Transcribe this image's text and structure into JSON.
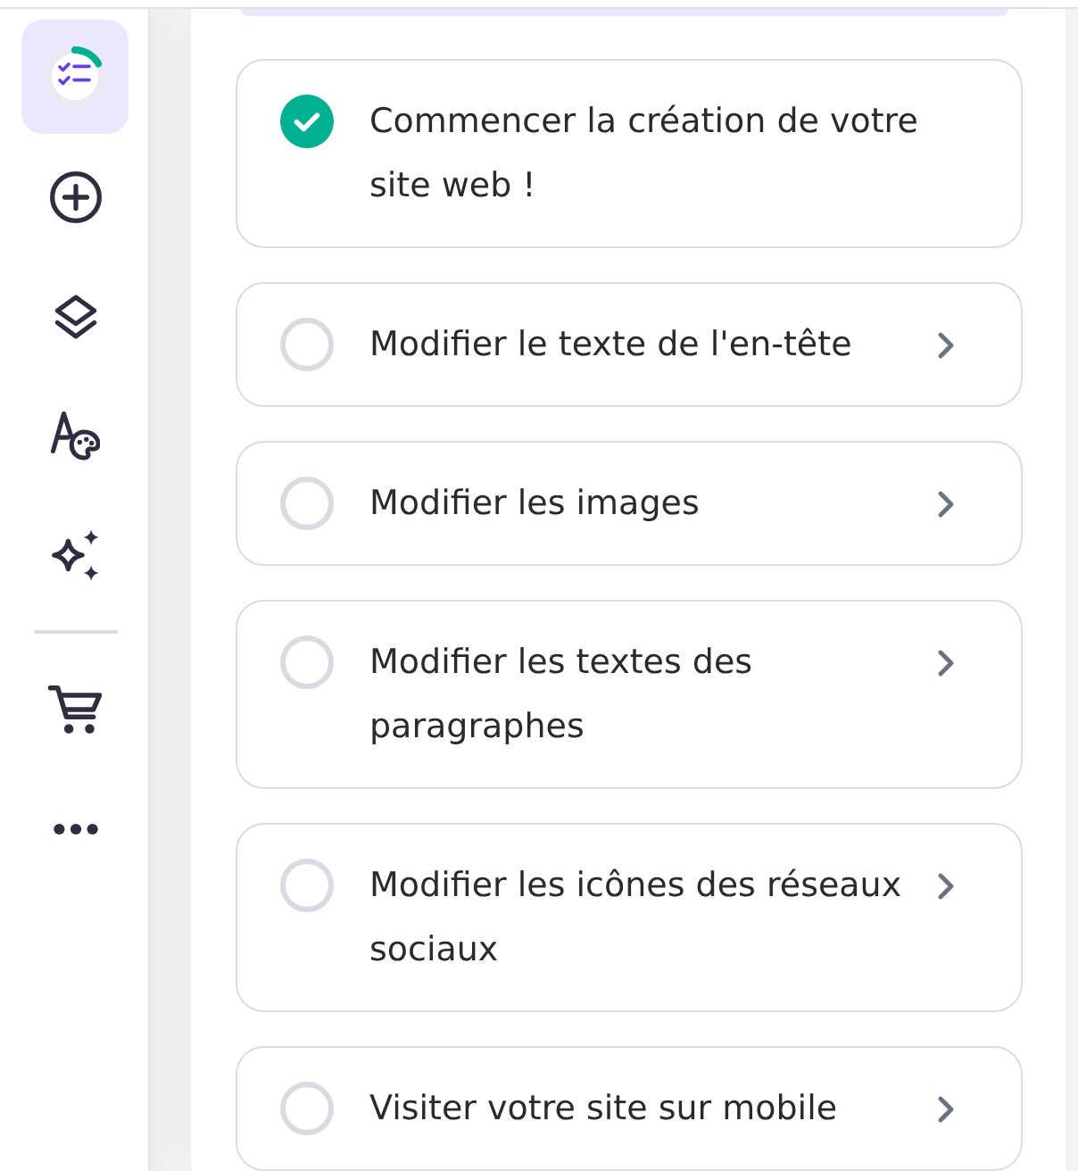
{
  "sidebar": {
    "items": [
      {
        "selected": true,
        "level": 0.17
      },
      {
        "selected": false
      },
      {
        "selected": false
      },
      {
        "selected": false
      },
      {
        "selected": false
      },
      {
        "selected": false
      },
      {
        "selected": false
      }
    ]
  },
  "tasks": [
    {
      "label": "Commencer la création de votre site web !",
      "done": true
    },
    {
      "label": "Modifier le texte de l'en-tête",
      "done": false
    },
    {
      "label": "Modifier les images",
      "done": false
    },
    {
      "label": "Modifier les textes des paragraphes",
      "done": false
    },
    {
      "label": "Modifier les icônes des réseaux sociaux",
      "done": false
    },
    {
      "label": "Visiter votre site sur mobile",
      "done": false
    }
  ]
}
